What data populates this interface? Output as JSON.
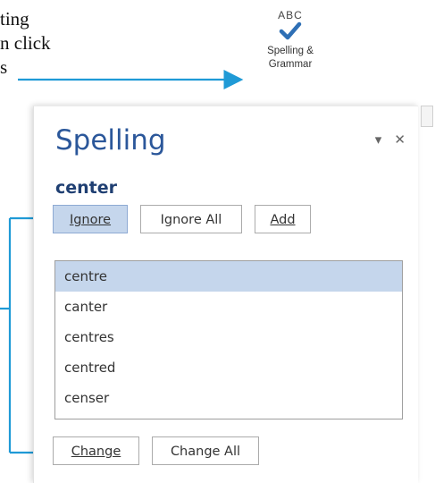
{
  "caption": {
    "line1": "ting",
    "line2": "n click",
    "line3": "s"
  },
  "ribbon_button": {
    "top_label": "ABC",
    "label_line1": "Spelling &",
    "label_line2": "Grammar",
    "icon": "checkmark-icon",
    "check_color": "#2e6fb5"
  },
  "pane": {
    "title": "Spelling",
    "menu_icon": "dropdown-arrow-icon",
    "close_icon": "close-icon",
    "misspelled_word": "center",
    "buttons": {
      "ignore": "Ignore",
      "ignore_all": "Ignore All",
      "add": "Add",
      "change": "Change",
      "change_all": "Change All"
    },
    "suggestions": [
      "centre",
      "canter",
      "centres",
      "centred",
      "censer"
    ],
    "selected_suggestion": "centre"
  },
  "colors": {
    "accent": "#2b579a",
    "selection": "#c5d6ec",
    "connector": "#1f9ad6"
  }
}
